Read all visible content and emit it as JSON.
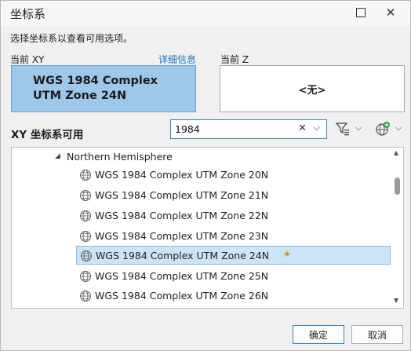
{
  "window": {
    "title": "坐标系",
    "close_glyph": "✕"
  },
  "description": "选择坐标系以查看可用选项。",
  "current_xy": {
    "label": "当前 XY",
    "detail_link": "详细信息",
    "value": "WGS 1984 Complex UTM Zone 24N"
  },
  "current_z": {
    "label": "当前 Z",
    "value": "<无>"
  },
  "available": {
    "label": "XY 坐标系可用"
  },
  "search": {
    "value": "1984",
    "clear_glyph": "✕",
    "dropdown_glyph": "⌵"
  },
  "toolbar": {
    "filter_icon": "filter-icon",
    "add_icon": "globe-add-icon",
    "dd_glyph": "⌵"
  },
  "tree": {
    "parent_label": "Northern Hemisphere",
    "expand_glyph": "◢",
    "items": [
      {
        "label": "WGS 1984 Complex UTM Zone 20N",
        "selected": false
      },
      {
        "label": "WGS 1984 Complex UTM Zone 21N",
        "selected": false
      },
      {
        "label": "WGS 1984 Complex UTM Zone 22N",
        "selected": false
      },
      {
        "label": "WGS 1984 Complex UTM Zone 23N",
        "selected": false
      },
      {
        "label": "WGS 1984 Complex UTM Zone 24N",
        "selected": true
      },
      {
        "label": "WGS 1984 Complex UTM Zone 25N",
        "selected": false
      },
      {
        "label": "WGS 1984 Complex UTM Zone 26N",
        "selected": false
      }
    ],
    "favorite_glyph": "★"
  },
  "buttons": {
    "ok": "确定",
    "cancel": "取消"
  },
  "colors": {
    "accent": "#1e73be",
    "selected_xy_bg": "#9ec8ea",
    "row_selected_bg": "#cce4f7"
  }
}
